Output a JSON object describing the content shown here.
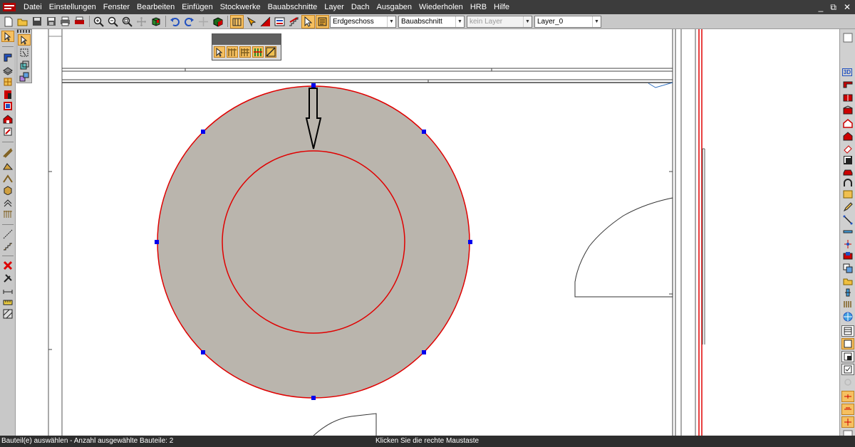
{
  "menubar": {
    "items": [
      "Datei",
      "Einstellungen",
      "Fenster",
      "Bearbeiten",
      "Einfügen",
      "Stockwerke",
      "Bauabschnitte",
      "Layer",
      "Dach",
      "Ausgaben",
      "Wiederholen",
      "HRB",
      "Hilfe"
    ],
    "window_controls": {
      "minimize": "_",
      "restore": "⧉",
      "close": "✕"
    }
  },
  "toolbar": {
    "floor_select": "Erdgeschoss",
    "section_select": "Bauabschnitt",
    "layer_filter_select": "kein Layer",
    "layer_select": "Layer_0"
  },
  "right_toolbar": {
    "label_3d": "3D"
  },
  "statusbar": {
    "left_text": "Bauteil(e) auswählen -  Anzahl ausgewählte Bauteile: 2",
    "center_text": "Klicken Sie die rechte Maustaste"
  },
  "colors": {
    "menubar_bg": "#3c3c3c",
    "toolbar_bg": "#c8c8c8",
    "selection_red": "#e00000",
    "ring_fill": "#bab5ad",
    "handle_blue": "#0000ee",
    "active_tool_orange": "#f6c060",
    "statusbar_bg": "#2e2e2e"
  },
  "icons": {
    "toolbar": [
      "new-file-icon",
      "open-folder-icon",
      "save-icon",
      "save-as-icon",
      "print-icon",
      "print-preview-icon",
      "zoom-in-icon",
      "zoom-out-icon",
      "zoom-window-icon",
      "pan-icon",
      "undo-icon",
      "redo-icon",
      "move-icon",
      "cube-icon",
      "wall-tool-icon",
      "pick-icon",
      "section-icon",
      "layer-icon",
      "stair-icon",
      "select-arrow-icon",
      "properties-icon"
    ],
    "palette": [
      "select-arrow-icon",
      "rail-icon",
      "rail-double-icon",
      "rail-green-icon",
      "hatch-icon"
    ]
  }
}
